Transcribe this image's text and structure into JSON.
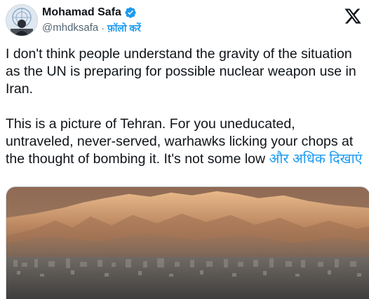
{
  "tweet": {
    "author": {
      "display_name": "Mohamad Safa",
      "handle": "@mhdksafa",
      "separator": "·",
      "follow_label": "फ़ॉलो करें",
      "verified": true,
      "verified_color": "#1d9bf0"
    },
    "text": {
      "paragraph1": "I don't think people understand the gravity of the situation as the UN is preparing for possible nuclear weapon use in Iran.",
      "paragraph2": "This is a picture of Tehran. For you uneducated, untraveled, never-served, warhawks licking your chops at the thought of bombing it. It's not some low",
      "show_more_label": "और अधिक दिखाएं"
    },
    "icons": {
      "avatar": "avatar-image",
      "verified": "verified-badge-icon",
      "platform": "x-logo-icon"
    },
    "colors": {
      "text": "#0f1419",
      "secondary": "#536471",
      "link": "#1d9bf0"
    }
  }
}
